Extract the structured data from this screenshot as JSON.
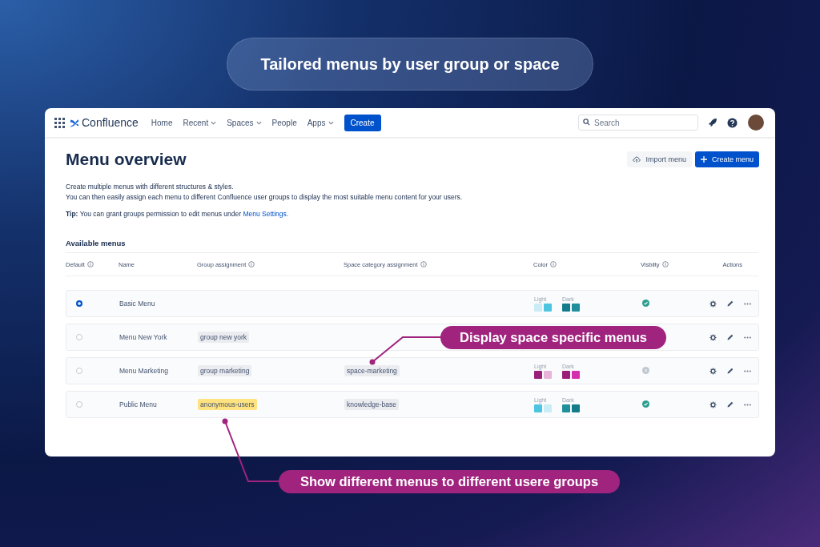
{
  "banner": {
    "title": "Tailored menus by user group or space"
  },
  "navbar": {
    "product": "Confluence",
    "items": [
      {
        "label": "Home",
        "dropdown": false
      },
      {
        "label": "Recent",
        "dropdown": true
      },
      {
        "label": "Spaces",
        "dropdown": true
      },
      {
        "label": "People",
        "dropdown": false
      },
      {
        "label": "Apps",
        "dropdown": true
      }
    ],
    "create_button": "Create",
    "search": {
      "placeholder": "Search"
    }
  },
  "page": {
    "title": "Menu overview",
    "buttons": [
      {
        "kind": "secondary",
        "label": "Import menu"
      },
      {
        "kind": "primary",
        "label": "Create menu"
      }
    ],
    "description": [
      "Create multiple menus with different structures & styles.",
      "You can then easily assign each menu to different Confluence user groups to display the most suitable menu content for your users."
    ],
    "tip": "**Tip:** You can grant groups permission to edit menus under ",
    "tip_link": "Menu Settings",
    "tip_end": "."
  },
  "table": {
    "title": "Available menus",
    "columns": [
      {
        "label": "Default",
        "info": true
      },
      {
        "label": "Name",
        "info": false
      },
      {
        "label": "Group assignment",
        "info": true
      },
      {
        "label": "Space category assignment",
        "info": true
      },
      {
        "label": "Color",
        "info": true
      },
      {
        "label": "Visbilty",
        "info": true
      },
      {
        "label": "Actions",
        "info": false
      }
    ],
    "rows": [
      {
        "selected": true,
        "name": "Basic Menu",
        "colors": {
          "light_label": "Light",
          "dark_label": "Dark",
          "light": [
            {
              "color": "#c9ecf7"
            },
            {
              "color": "#4cc6e0"
            }
          ],
          "dark": [
            {
              "color": "#137b8a"
            },
            {
              "color": "#1f8f9b"
            }
          ]
        },
        "visible": true
      },
      {
        "selected": false,
        "name": "Menu New York",
        "group": {
          "label": "group new york",
          "highlighted": false
        }
      },
      {
        "selected": false,
        "name": "Menu Marketing",
        "group": {
          "label": "group marketing",
          "highlighted": false
        },
        "space": "space-marketing",
        "colors": {
          "light_label": "Light",
          "dark_label": "Dark",
          "light": [
            {
              "color": "#9a1f76"
            },
            {
              "color": "#e8b3d9"
            }
          ],
          "dark": [
            {
              "color": "#9a1f76"
            },
            {
              "color": "#d42fae"
            }
          ]
        },
        "visible": false
      },
      {
        "selected": false,
        "name": "Public Menu",
        "group": {
          "label": "anonymous-users",
          "highlighted": true
        },
        "space": "knowledge-base",
        "colors": {
          "light_label": "Light",
          "dark_label": "Dark",
          "light": [
            {
              "color": "#4cc6e0"
            },
            {
              "color": "#c9ecf7"
            }
          ],
          "dark": [
            {
              "color": "#1f8f9b"
            },
            {
              "color": "#137b8a"
            }
          ]
        },
        "visible": true
      }
    ]
  },
  "callouts": [
    {
      "text": "Display space specific menus"
    },
    {
      "text": "Show different menus to different usere groups"
    }
  ]
}
